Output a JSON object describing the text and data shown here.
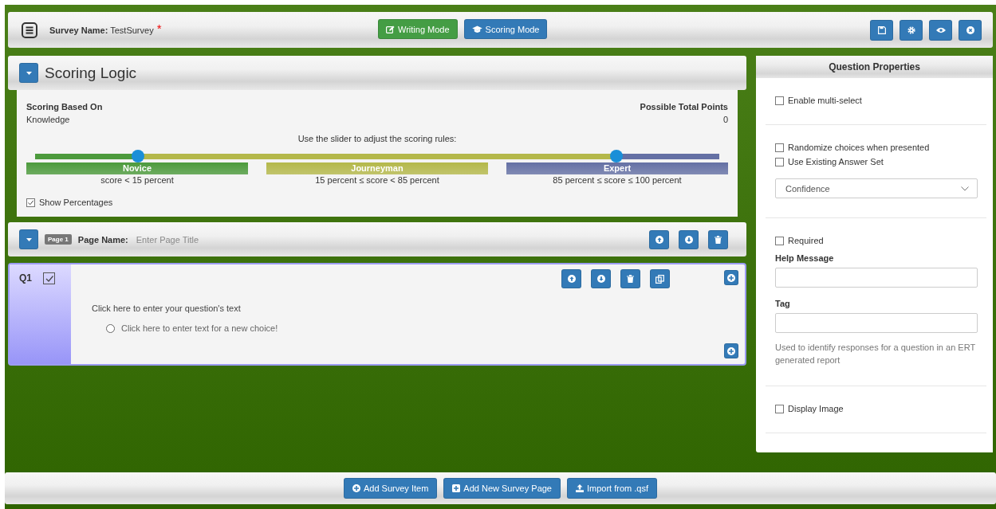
{
  "header": {
    "survey_name_label": "Survey Name:",
    "survey_name": "TestSurvey",
    "required_mark": "*",
    "modes": [
      {
        "label": "Writing Mode",
        "kind": "writing",
        "color": "#449d44"
      },
      {
        "label": "Scoring Mode",
        "kind": "scoring",
        "color": "#337ab7"
      }
    ]
  },
  "scoring": {
    "title": "Scoring Logic",
    "based_on_label": "Scoring Based On",
    "based_on_value": "Knowledge",
    "total_label": "Possible Total Points",
    "total_value": "0",
    "instruction": "Use the slider to adjust the scoring rules:",
    "thumbs": [
      {
        "level": 0.15
      },
      {
        "level": 0.85
      }
    ],
    "bands": [
      {
        "name": "Novice",
        "color": "#4c9a3c",
        "range": "score < 15 percent"
      },
      {
        "name": "Journeyman",
        "color": "#b4b84a",
        "range": "15 percent ≤ score < 85 percent"
      },
      {
        "name": "Expert",
        "color": "#6470a4",
        "range": "85 percent ≤ score ≤ 100 percent"
      }
    ],
    "show_percentages": {
      "label": "Show Percentages",
      "checked": true
    }
  },
  "page": {
    "badge": "Page 1",
    "name_label": "Page Name:",
    "placeholder": "Enter Page Title"
  },
  "question": {
    "number": "Q1",
    "checked": true,
    "text": "Click here to enter your question's text",
    "choices": [
      {
        "text": "Click here to enter text for a new choice!",
        "selected": false
      }
    ]
  },
  "properties": {
    "title": "Question Properties",
    "sections": [
      [
        {
          "kind": "checkbox",
          "label": "Enable multi-select",
          "checked": false
        }
      ],
      [
        {
          "kind": "checkbox",
          "label": "Randomize choices when presented",
          "checked": false
        },
        {
          "kind": "checkbox",
          "label": "Use Existing Answer Set",
          "checked": false
        },
        {
          "kind": "select",
          "value": "Confidence"
        }
      ],
      [
        {
          "kind": "checkbox",
          "label": "Required",
          "checked": false
        },
        {
          "kind": "field",
          "label": "Help Message"
        },
        {
          "kind": "field",
          "label": "Tag"
        },
        {
          "kind": "note",
          "text": "Used to identify responses for a question in an ERT generated report"
        }
      ],
      [
        {
          "kind": "checkbox",
          "label": "Display Image",
          "checked": false
        }
      ]
    ]
  },
  "footer": {
    "buttons": [
      {
        "label": "Add Survey Item",
        "kind": "plus-circle"
      },
      {
        "label": "Add New Survey Page",
        "kind": "plus-square"
      },
      {
        "label": "Import from .qsf",
        "kind": "upload"
      }
    ]
  }
}
